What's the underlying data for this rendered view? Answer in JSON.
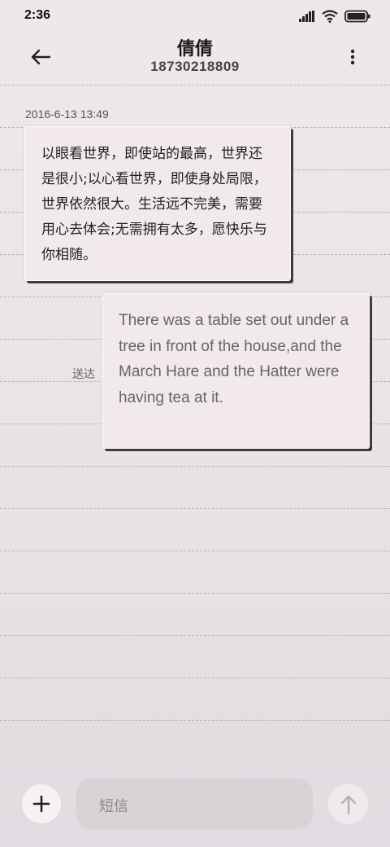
{
  "status_bar": {
    "time": "2:36",
    "icons": [
      "signal-icon",
      "wifi-icon",
      "battery-icon"
    ]
  },
  "header": {
    "contact_name": "倩倩",
    "phone_number": "18730218809",
    "back_icon": "arrow-left-icon",
    "more_icon": "more-vertical-icon"
  },
  "conversation": {
    "timestamp": "2016-6-13 13:49",
    "messages": [
      {
        "direction": "incoming",
        "text": "以眼看世界，即使站的最高，世界还是很小;以心看世界，即使身处局限，世界依然很大。生活远不完美，需要用心去体会;无需拥有太多，愿快乐与你相随。"
      },
      {
        "direction": "outgoing",
        "text": "There was a table set out under a tree in front of the house,and the March Hare and the Hatter were having tea at it.",
        "status": "送达"
      }
    ]
  },
  "composer": {
    "placeholder": "短信",
    "add_icon": "plus-icon",
    "send_icon": "arrow-up-icon"
  },
  "colors": {
    "background": "#efe8e8",
    "bubble": "#f1e9ea",
    "bubble_shadow": "#3d3a3c",
    "input_box": "#d9d3d7"
  }
}
